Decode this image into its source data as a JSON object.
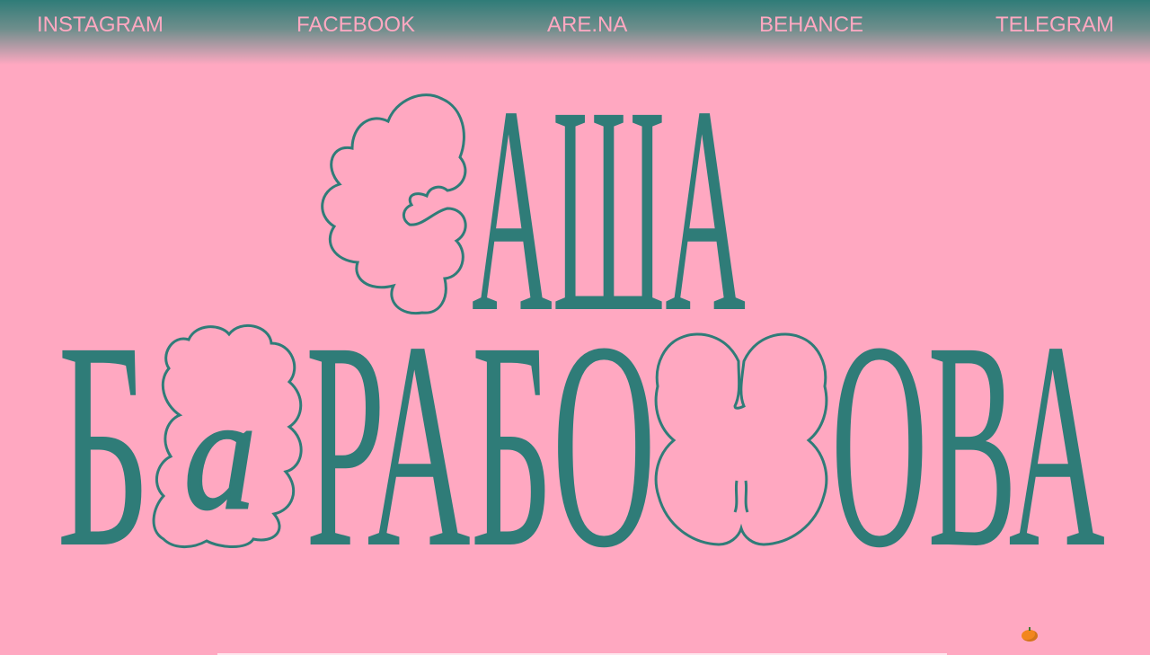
{
  "nav": {
    "items": [
      {
        "label": "INSTAGRAM",
        "icon": ""
      },
      {
        "label": "FACEBOOK",
        "icon": ""
      },
      {
        "label": "ARE.NA",
        "icon": ""
      },
      {
        "label": "BEHANCE",
        "icon": ""
      },
      {
        "label": "TELEGRAM",
        "icon": ""
      }
    ]
  },
  "hero": {
    "line1": "АША",
    "line2_part1": "Б",
    "line2_part2": "РАБО",
    "line2_part3": "ОВА",
    "decor_letter_a": "a",
    "decor_icons": [
      "flower-s-icon",
      "flower-a-icon",
      "flower-sh-icon"
    ]
  },
  "colors": {
    "background": "#FFA8C1",
    "accent": "#2F7C78",
    "pumpkin": "#F2861E"
  },
  "corner_icon": "pumpkin-icon"
}
